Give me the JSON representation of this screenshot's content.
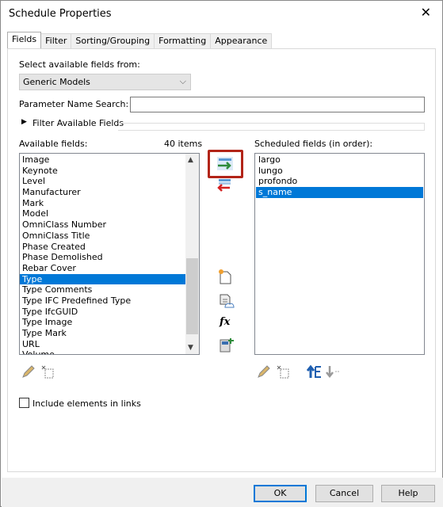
{
  "window": {
    "title": "Schedule Properties",
    "close": "✕"
  },
  "tabs": [
    "Fields",
    "Filter",
    "Sorting/Grouping",
    "Formatting",
    "Appearance"
  ],
  "fields": {
    "select_label": "Select available fields from:",
    "select_value": "Generic Models",
    "search_label": "Parameter Name Search:",
    "search_value": "",
    "filter_label": "Filter Available Fields",
    "available_label": "Available fields:",
    "available_count": "40 items",
    "available": [
      "Image",
      "Keynote",
      "Level",
      "Manufacturer",
      "Mark",
      "Model",
      "OmniClass Number",
      "OmniClass Title",
      "Phase Created",
      "Phase Demolished",
      "Rebar Cover",
      "Type",
      "Type Comments",
      "Type IFC Predefined Type",
      "Type IfcGUID",
      "Type Image",
      "Type Mark",
      "URL",
      "Volume"
    ],
    "available_selected": "Type",
    "scheduled_label": "Scheduled fields (in order):",
    "scheduled": [
      "largo",
      "lungo",
      "profondo",
      "s_name"
    ],
    "scheduled_selected": "s_name",
    "include_links": "Include elements in links",
    "include_links_checked": false,
    "highlight_color": "#b22418",
    "selection_color": "#0078d7"
  },
  "footer": {
    "ok": "OK",
    "cancel": "Cancel",
    "help": "Help"
  }
}
